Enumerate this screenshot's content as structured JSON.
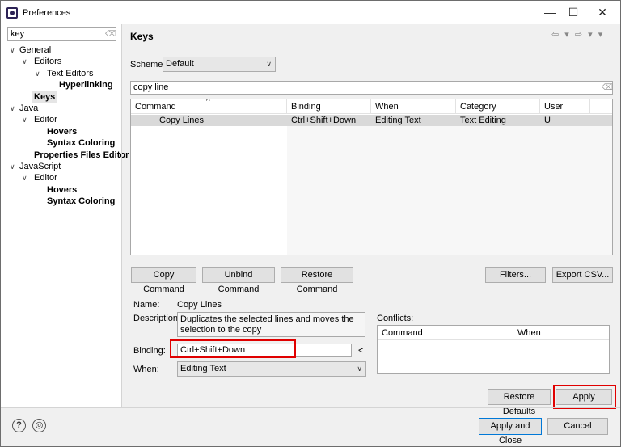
{
  "window": {
    "title": "Preferences",
    "minimize": "—",
    "maximize": "☐",
    "close": "✕"
  },
  "filter": {
    "value": "key",
    "clear_icon": "⌫"
  },
  "tree": [
    {
      "label": "General",
      "level": 0,
      "arrow": "v",
      "bold": false
    },
    {
      "label": "Editors",
      "level": 1,
      "arrow": "v",
      "bold": false
    },
    {
      "label": "Text Editors",
      "level": 2,
      "arrow": "v",
      "bold": false
    },
    {
      "label": "Hyperlinking",
      "level": 3,
      "arrow": "",
      "bold": true
    },
    {
      "label": "Keys",
      "level": 1,
      "arrow": "",
      "bold": true,
      "selected": true
    },
    {
      "label": "Java",
      "level": 0,
      "arrow": "v",
      "bold": false
    },
    {
      "label": "Editor",
      "level": 1,
      "arrow": "v",
      "bold": false
    },
    {
      "label": "Hovers",
      "level": 2,
      "arrow": "",
      "bold": true
    },
    {
      "label": "Syntax Coloring",
      "level": 2,
      "arrow": "",
      "bold": true
    },
    {
      "label": "Properties Files Editor",
      "level": 1,
      "arrow": "",
      "bold": true
    },
    {
      "label": "JavaScript",
      "level": 0,
      "arrow": "v",
      "bold": false
    },
    {
      "label": "Editor",
      "level": 1,
      "arrow": "v",
      "bold": false
    },
    {
      "label": "Hovers",
      "level": 2,
      "arrow": "",
      "bold": true
    },
    {
      "label": "Syntax Coloring",
      "level": 2,
      "arrow": "",
      "bold": true
    }
  ],
  "page": {
    "title": "Keys",
    "nav_icons": "⇦ ▾ ⇨ ▾ ▾"
  },
  "scheme": {
    "label": "Scheme:",
    "value": "Default"
  },
  "search": {
    "value": "copy line"
  },
  "table": {
    "headers": [
      "Command",
      "Binding",
      "When",
      "Category",
      "User"
    ],
    "sort_indicator": "^",
    "rows": [
      [
        "Copy Lines",
        "Ctrl+Shift+Down",
        "Editing Text",
        "Text Editing",
        "U"
      ]
    ]
  },
  "buttons": {
    "copy_command": "Copy Command",
    "unbind_command": "Unbind Command",
    "restore_command": "Restore Command",
    "filters": "Filters...",
    "export_csv": "Export CSV...",
    "restore_defaults": "Restore Defaults",
    "apply": "Apply",
    "apply_and_close": "Apply and Close",
    "cancel": "Cancel"
  },
  "details": {
    "name_label": "Name:",
    "name_value": "Copy Lines",
    "description_label": "Description:",
    "description_value": "Duplicates the selected lines and moves the selection to the copy",
    "binding_label": "Binding:",
    "binding_value": "Ctrl+Shift+Down",
    "binding_menu": "<",
    "when_label": "When:",
    "when_value": "Editing Text"
  },
  "conflicts": {
    "label": "Conflicts:",
    "headers": [
      "Command",
      "When"
    ]
  },
  "footer": {
    "help_icon": "?",
    "import_export_icon": "◎"
  },
  "colors": {
    "highlight": "#e00000",
    "selected_row": "#d9d9d9"
  }
}
